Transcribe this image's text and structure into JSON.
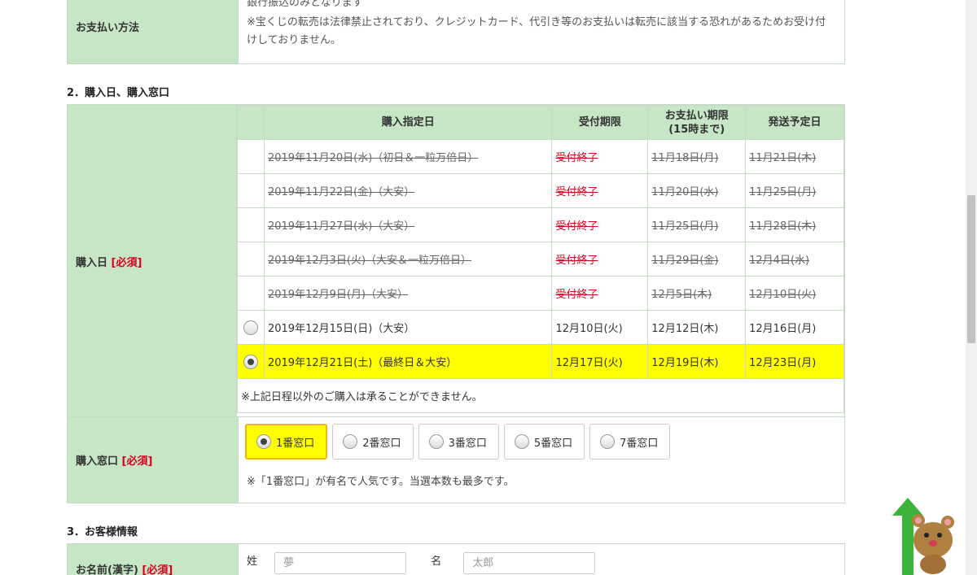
{
  "payment": {
    "label": "お支払い方法",
    "top_clip": "銀行振込のみとなります",
    "note": "※宝くじの転売は法律禁止されており、クレジットカード、代引き等のお支払いは転売に該当する恐れがあるためお受け付けしておりません。"
  },
  "section2": {
    "title": "2．購入日、購入窓口"
  },
  "schedule": {
    "label": "購入日",
    "required": "[必須]",
    "headers": {
      "date": "購入指定日",
      "deadline": "受付期限",
      "pay_line1": "お支払い期限",
      "pay_line2": "(15時まで)",
      "ship": "発送予定日"
    },
    "rows": [
      {
        "date": "2019年11月20日(水)（初日＆一粒万倍日）",
        "deadline": "受付終了",
        "pay": "11月18日(月)",
        "ship": "11月21日(木)"
      },
      {
        "date": "2019年11月22日(金)（大安）",
        "deadline": "受付終了",
        "pay": "11月20日(水)",
        "ship": "11月25日(月)"
      },
      {
        "date": "2019年11月27日(水)（大安）",
        "deadline": "受付終了",
        "pay": "11月25日(月)",
        "ship": "11月28日(木)"
      },
      {
        "date": "2019年12月3日(火)（大安＆一粒万倍日）",
        "deadline": "受付終了",
        "pay": "11月29日(金)",
        "ship": "12月4日(水)"
      },
      {
        "date": "2019年12月9日(月)（大安）",
        "deadline": "受付終了",
        "pay": "12月5日(木)",
        "ship": "12月10日(火)"
      },
      {
        "date": "2019年12月15日(日)（大安）",
        "deadline": "12月10日(火)",
        "pay": "12月12日(木)",
        "ship": "12月16日(月)"
      },
      {
        "date": "2019年12月21日(土)（最終日＆大安）",
        "deadline": "12月17日(火)",
        "pay": "12月19日(木)",
        "ship": "12月23日(月)"
      }
    ],
    "note": "※上記日程以外のご購入は承ることができません。"
  },
  "window": {
    "label": "購入窓口",
    "required": "[必須]",
    "options": [
      "1番窓口",
      "2番窓口",
      "3番窓口",
      "5番窓口",
      "7番窓口"
    ],
    "note": "※「1番窓口」が有名で人気です。当選本数も最多です。"
  },
  "section3": {
    "title": "3．お客様情報"
  },
  "name": {
    "label": "お名前(漢字)",
    "required": "[必須]",
    "last_label": "姓",
    "last_placeholder": "夢",
    "first_label": "名",
    "first_placeholder": "太郎"
  },
  "colors": {
    "label_bg": "#c6e6c6",
    "selected_bg": "#ffff00",
    "required": "#d8001e",
    "active_border": "#f1b21a"
  }
}
